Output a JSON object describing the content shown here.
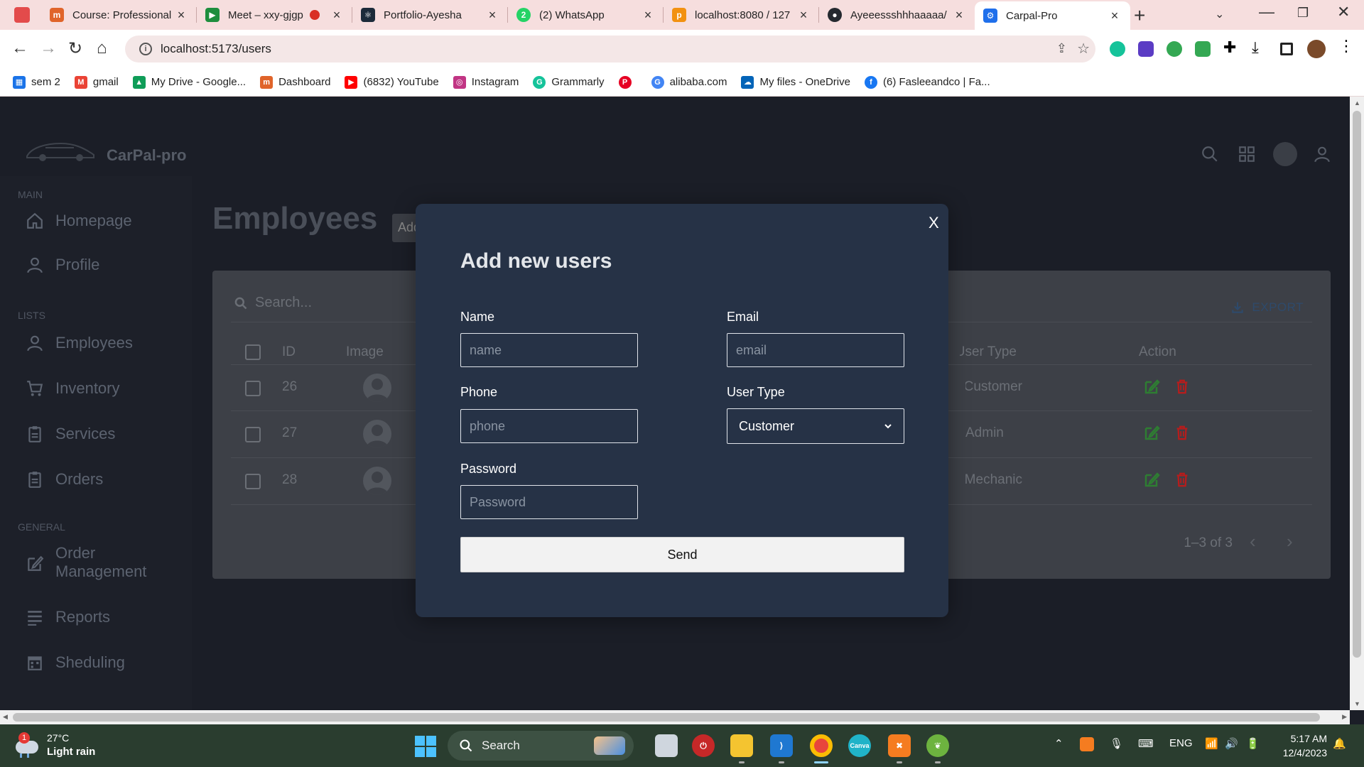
{
  "browser": {
    "tabs": [
      {
        "title": "Course: Professional",
        "icon": "moodle-icon",
        "color": "#e0642a"
      },
      {
        "title": "Meet – xxy-gjgp",
        "icon": "meet-icon",
        "color": "#1e8e3e"
      },
      {
        "title": "Portfolio-Ayesha",
        "icon": "react-icon",
        "color": "#1c2b3a"
      },
      {
        "title": "(2) WhatsApp",
        "icon": "whatsapp-icon",
        "color": "#25d366"
      },
      {
        "title": "localhost:8080 / 127",
        "icon": "phpmyadmin-icon",
        "color": "#f29111"
      },
      {
        "title": "Ayeeessshhhaaaaa/",
        "icon": "github-icon",
        "color": "#24292f"
      },
      {
        "title": "Carpal-Pro",
        "icon": "gear-icon",
        "color": "#1f6feb"
      }
    ],
    "url": "localhost:5173/users",
    "bookmarks": [
      {
        "label": "sem 2",
        "color": "#1a73e8"
      },
      {
        "label": "gmail",
        "color": "#ea4335"
      },
      {
        "label": "My Drive - Google...",
        "color": "#0f9d58"
      },
      {
        "label": "Dashboard",
        "color": "#e0642a"
      },
      {
        "label": "(6832) YouTube",
        "color": "#ff0000"
      },
      {
        "label": "Instagram",
        "color": "#c13584"
      },
      {
        "label": "Grammarly",
        "color": "#15c39a"
      },
      {
        "label": "",
        "color": "#e60023"
      },
      {
        "label": "alibaba.com",
        "color": "#4285f4"
      },
      {
        "label": "My files - OneDrive",
        "color": "#0364b8"
      },
      {
        "label": "(6) Fasleeandco | Fa...",
        "color": "#1877f2"
      }
    ]
  },
  "app": {
    "brand": "CarPal-pro",
    "sidebar": {
      "sections": [
        {
          "title": "MAIN",
          "items": [
            "Homepage",
            "Profile"
          ]
        },
        {
          "title": "LISTS",
          "items": [
            "Employees",
            "Inventory",
            "Services",
            "Orders"
          ]
        },
        {
          "title": "GENERAL",
          "items": [
            "Order Management",
            "Reports",
            "Sheduling"
          ]
        }
      ],
      "order_mgmt_line1": "Order",
      "order_mgmt_line2": "Management"
    },
    "page_title": "Employees",
    "add_button": "Add New",
    "table": {
      "search_placeholder": "Search...",
      "export_label": "EXPORT",
      "columns": [
        "ID",
        "Image",
        "User Type",
        "Action"
      ],
      "rows": [
        {
          "id": "26",
          "user_type": "Customer"
        },
        {
          "id": "27",
          "user_type": "Admin"
        },
        {
          "id": "28",
          "user_type": "Mechanic"
        }
      ],
      "pagination": "1–3 of 3"
    }
  },
  "modal": {
    "close": "X",
    "title": "Add new users",
    "fields": {
      "name_label": "Name",
      "name_placeholder": "name",
      "email_label": "Email",
      "email_placeholder": "email",
      "phone_label": "Phone",
      "phone_placeholder": "phone",
      "usertype_label": "User Type",
      "usertype_value": "Customer",
      "password_label": "Password",
      "password_placeholder": "Password"
    },
    "send": "Send"
  },
  "taskbar": {
    "temp": "27°C",
    "condition": "Light rain",
    "badge": "1",
    "search": "Search",
    "lang": "ENG",
    "time": "5:17 AM",
    "date": "12/4/2023"
  },
  "colors": {
    "modal_bg": "#263246",
    "edit_green": "#2e7d32",
    "delete_red": "#b71c1c",
    "tabbar_pink": "#f6dede"
  }
}
